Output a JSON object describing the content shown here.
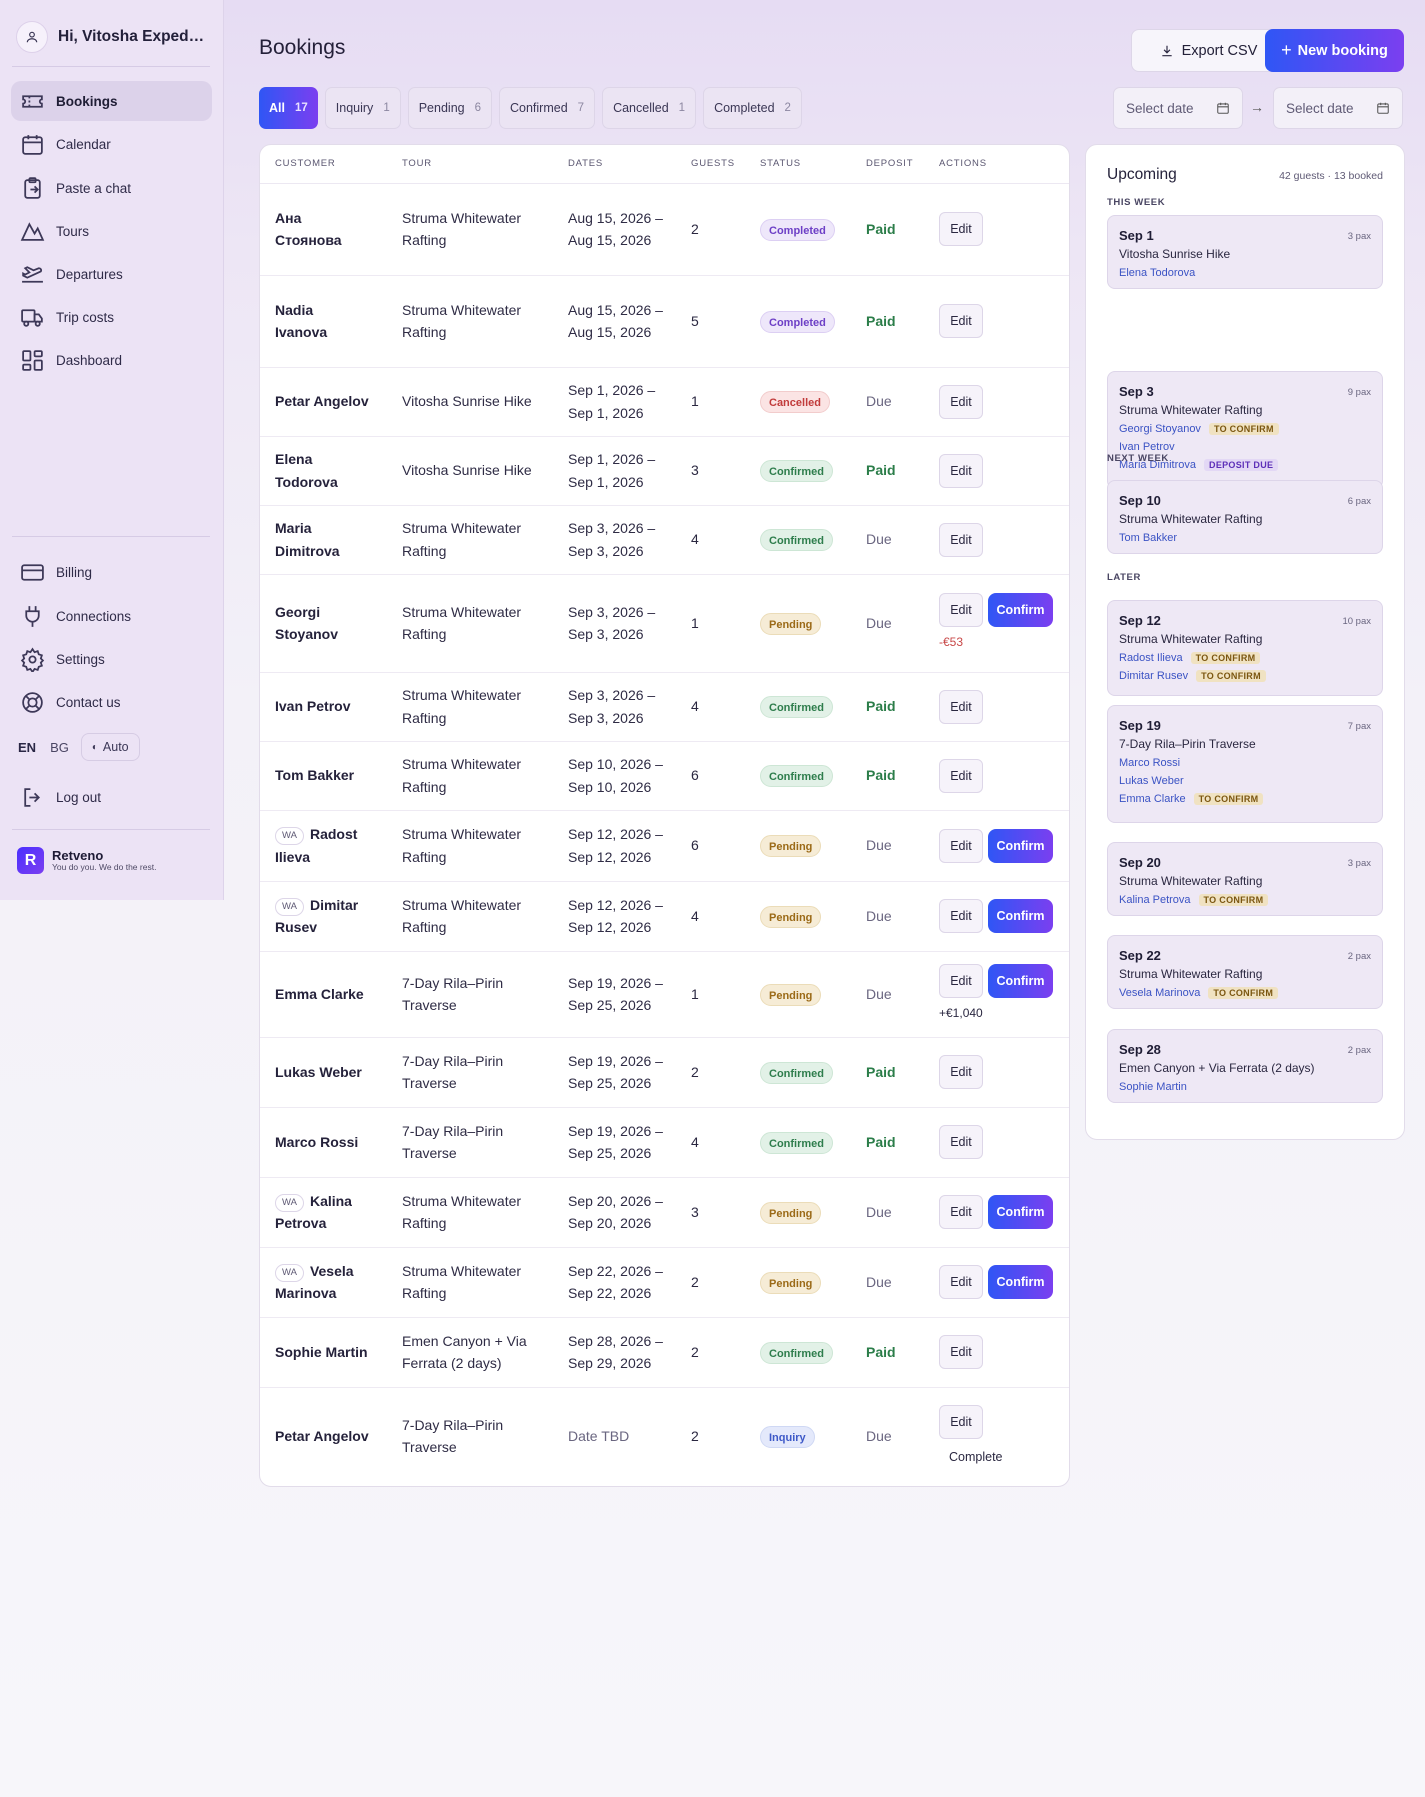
{
  "sidebar": {
    "greeting": "Hi, Vitosha Expediti...",
    "nav": [
      {
        "label": "Bookings",
        "icon": "ticket-icon"
      },
      {
        "label": "Calendar",
        "icon": "calendar-icon"
      },
      {
        "label": "Paste a chat",
        "icon": "clipboard-icon"
      },
      {
        "label": "Tours",
        "icon": "mountain-icon"
      },
      {
        "label": "Departures",
        "icon": "plane-icon"
      },
      {
        "label": "Trip costs",
        "icon": "truck-icon"
      },
      {
        "label": "Dashboard",
        "icon": "grid-icon"
      }
    ],
    "secondary": [
      {
        "label": "Billing",
        "icon": "card-icon"
      },
      {
        "label": "Connections",
        "icon": "plug-icon"
      },
      {
        "label": "Settings",
        "icon": "gear-icon"
      },
      {
        "label": "Contact us",
        "icon": "lifebuoy-icon"
      }
    ],
    "lang_en": "EN",
    "lang_bg": "BG",
    "theme": "Auto",
    "logout": "Log out",
    "brand_name": "Retveno",
    "brand_tagline": "You do you. We do the rest."
  },
  "header": {
    "title": "Bookings",
    "export_label": "Export CSV",
    "new_label": "New booking"
  },
  "tabs": [
    {
      "label": "All",
      "count": "17"
    },
    {
      "label": "Inquiry",
      "count": "1"
    },
    {
      "label": "Pending",
      "count": "6"
    },
    {
      "label": "Confirmed",
      "count": "7"
    },
    {
      "label": "Cancelled",
      "count": "1"
    },
    {
      "label": "Completed",
      "count": "2"
    }
  ],
  "date_filter": {
    "from_placeholder": "Select date",
    "to_placeholder": "Select date",
    "arrow": "→"
  },
  "table": {
    "headers": [
      "CUSTOMER",
      "TOUR",
      "DATES",
      "GUESTS",
      "STATUS",
      "DEPOSIT",
      "ACTIONS"
    ],
    "edit_label": "Edit",
    "confirm_label": "Confirm",
    "wa_label": "WA",
    "rows": [
      {
        "customer": "Ана Стоянова",
        "wa": false,
        "tour": "Struma Whitewater Rafting",
        "dates": "Aug 15, 2026 – Aug 15, 2026",
        "guests": "2",
        "status": "Completed",
        "deposit": "Paid",
        "confirm": false,
        "note": ""
      },
      {
        "customer": "Nadia Ivanova",
        "wa": false,
        "tour": "Struma Whitewater Rafting",
        "dates": "Aug 15, 2026 – Aug 15, 2026",
        "guests": "5",
        "status": "Completed",
        "deposit": "Paid",
        "confirm": false,
        "note": ""
      },
      {
        "customer": "Petar Angelov",
        "wa": false,
        "tour": "Vitosha Sunrise Hike",
        "dates": "Sep 1, 2026 – Sep 1, 2026",
        "guests": "1",
        "status": "Cancelled",
        "deposit": "Due",
        "confirm": false,
        "note": ""
      },
      {
        "customer": "Elena Todorova",
        "wa": false,
        "tour": "Vitosha Sunrise Hike",
        "dates": "Sep 1, 2026 – Sep 1, 2026",
        "guests": "3",
        "status": "Confirmed",
        "deposit": "Paid",
        "confirm": false,
        "note": ""
      },
      {
        "customer": "Maria Dimitrova",
        "wa": false,
        "tour": "Struma Whitewater Rafting",
        "dates": "Sep 3, 2026 – Sep 3, 2026",
        "guests": "4",
        "status": "Confirmed",
        "deposit": "Due",
        "confirm": false,
        "note": ""
      },
      {
        "customer": "Georgi Stoyanov",
        "wa": false,
        "tour": "Struma Whitewater Rafting",
        "dates": "Sep 3, 2026 – Sep 3, 2026",
        "guests": "1",
        "status": "Pending",
        "deposit": "Due",
        "confirm": true,
        "note": "-€53"
      },
      {
        "customer": "Ivan Petrov",
        "wa": false,
        "tour": "Struma Whitewater Rafting",
        "dates": "Sep 3, 2026 – Sep 3, 2026",
        "guests": "4",
        "status": "Confirmed",
        "deposit": "Paid",
        "confirm": false,
        "note": ""
      },
      {
        "customer": "Tom Bakker",
        "wa": false,
        "tour": "Struma Whitewater Rafting",
        "dates": "Sep 10, 2026 – Sep 10, 2026",
        "guests": "6",
        "status": "Confirmed",
        "deposit": "Paid",
        "confirm": false,
        "note": ""
      },
      {
        "customer": "Radost Ilieva",
        "wa": true,
        "tour": "Struma Whitewater Rafting",
        "dates": "Sep 12, 2026 – Sep 12, 2026",
        "guests": "6",
        "status": "Pending",
        "deposit": "Due",
        "confirm": true,
        "note": ""
      },
      {
        "customer": "Dimitar Rusev",
        "wa": true,
        "tour": "Struma Whitewater Rafting",
        "dates": "Sep 12, 2026 – Sep 12, 2026",
        "guests": "4",
        "status": "Pending",
        "deposit": "Due",
        "confirm": true,
        "note": ""
      },
      {
        "customer": "Emma Clarke",
        "wa": false,
        "tour": "7-Day Rila–Pirin Traverse",
        "dates": "Sep 19, 2026 – Sep 25, 2026",
        "guests": "1",
        "status": "Pending",
        "deposit": "Due",
        "confirm": true,
        "note": "+€1,040"
      },
      {
        "customer": "Lukas Weber",
        "wa": false,
        "tour": "7-Day Rila–Pirin Traverse",
        "dates": "Sep 19, 2026 – Sep 25, 2026",
        "guests": "2",
        "status": "Confirmed",
        "deposit": "Paid",
        "confirm": false,
        "note": ""
      },
      {
        "customer": "Marco Rossi",
        "wa": false,
        "tour": "7-Day Rila–Pirin Traverse",
        "dates": "Sep 19, 2026 – Sep 25, 2026",
        "guests": "4",
        "status": "Confirmed",
        "deposit": "Paid",
        "confirm": false,
        "note": ""
      },
      {
        "customer": "Kalina Petrova",
        "wa": true,
        "tour": "Struma Whitewater Rafting",
        "dates": "Sep 20, 2026 – Sep 20, 2026",
        "guests": "3",
        "status": "Pending",
        "deposit": "Due",
        "confirm": true,
        "note": ""
      },
      {
        "customer": "Vesela Marinova",
        "wa": true,
        "tour": "Struma Whitewater Rafting",
        "dates": "Sep 22, 2026 – Sep 22, 2026",
        "guests": "2",
        "status": "Pending",
        "deposit": "Due",
        "confirm": true,
        "note": ""
      },
      {
        "customer": "Sophie Martin",
        "wa": false,
        "tour": "Emen Canyon + Via Ferrata (2 days)",
        "dates": "Sep 28, 2026 – Sep 29, 2026",
        "guests": "2",
        "status": "Confirmed",
        "deposit": "Paid",
        "confirm": false,
        "note": ""
      },
      {
        "customer": "Petar Angelov",
        "wa": false,
        "tour": "7-Day Rila–Pirin Traverse",
        "dates": "Date TBD",
        "guests": "2",
        "status": "Inquiry",
        "deposit": "Due",
        "confirm": false,
        "note": "",
        "complete": "Complete"
      }
    ]
  },
  "upcoming": {
    "title": "Upcoming",
    "summary": "42 guests · 13 booked",
    "sections": [
      {
        "label": "THIS WEEK",
        "items": [
          {
            "date": "Sep 1",
            "pax": "3 pax",
            "tour": "Vitosha Sunrise Hike",
            "people": [
              {
                "name": "Elena Todorova",
                "tag": ""
              }
            ]
          },
          {
            "date": "Sep 3",
            "pax": "9 pax",
            "tour": "Struma Whitewater Rafting",
            "people": [
              {
                "name": "Georgi Stoyanov",
                "tag": "TO CONFIRM"
              },
              {
                "name": "Ivan Petrov",
                "tag": ""
              },
              {
                "name": "Maria Dimitrova",
                "tag": "DEPOSIT DUE"
              }
            ]
          }
        ]
      },
      {
        "label": "NEXT WEEK",
        "items": [
          {
            "date": "Sep 10",
            "pax": "6 pax",
            "tour": "Struma Whitewater Rafting",
            "people": [
              {
                "name": "Tom Bakker",
                "tag": ""
              }
            ]
          }
        ]
      },
      {
        "label": "LATER",
        "items": [
          {
            "date": "Sep 12",
            "pax": "10 pax",
            "tour": "Struma Whitewater Rafting",
            "people": [
              {
                "name": "Radost Ilieva",
                "tag": "TO CONFIRM"
              },
              {
                "name": "Dimitar Rusev",
                "tag": "TO CONFIRM"
              }
            ]
          },
          {
            "date": "Sep 19",
            "pax": "7 pax",
            "tour": "7-Day Rila–Pirin Traverse",
            "people": [
              {
                "name": "Marco Rossi",
                "tag": ""
              },
              {
                "name": "Lukas Weber",
                "tag": ""
              },
              {
                "name": "Emma Clarke",
                "tag": "TO CONFIRM"
              }
            ]
          },
          {
            "date": "Sep 20",
            "pax": "3 pax",
            "tour": "Struma Whitewater Rafting",
            "people": [
              {
                "name": "Kalina Petrova",
                "tag": "TO CONFIRM"
              }
            ]
          },
          {
            "date": "Sep 22",
            "pax": "2 pax",
            "tour": "Struma Whitewater Rafting",
            "people": [
              {
                "name": "Vesela Marinova",
                "tag": "TO CONFIRM"
              }
            ]
          },
          {
            "date": "Sep 28",
            "pax": "2 pax",
            "tour": "Emen Canyon + Via Ferrata (2 days)",
            "people": [
              {
                "name": "Sophie Martin",
                "tag": ""
              }
            ]
          }
        ]
      }
    ]
  }
}
